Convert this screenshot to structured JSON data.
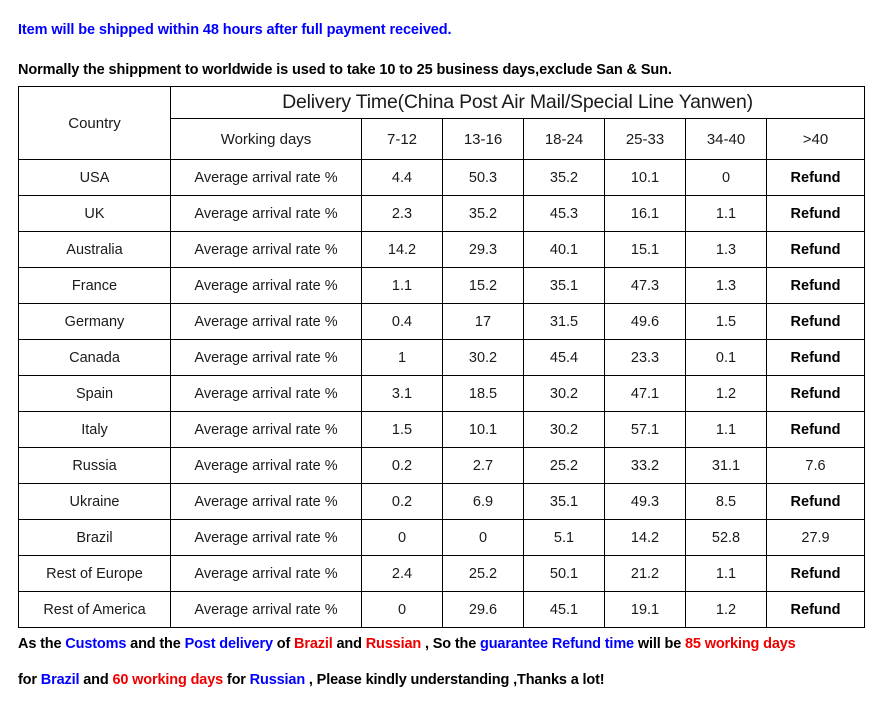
{
  "notices": {
    "line1": "Item will be shipped within 48 hours after full payment received.",
    "line2": "Normally the shippment to worldwide is used to take 10 to 25 business days,exclude San & Sun."
  },
  "colors": {
    "blue": "#0000ff",
    "red": "#ee0000",
    "black": "#000000",
    "border": "#000000",
    "background": "#ffffff"
  },
  "table": {
    "country_header": "Country",
    "title_header": "Delivery Time(China Post Air Mail/Special Line Yanwen)",
    "working_days_header": "Working days",
    "band_headers": [
      "7-12",
      "13-16",
      "18-24",
      "25-33",
      "34-40",
      ">40"
    ],
    "metric_label": "Average arrival rate %",
    "rows": [
      {
        "country": "USA",
        "values": [
          "4.4",
          "50.3",
          "35.2",
          "10.1",
          "0",
          "Refund"
        ]
      },
      {
        "country": "UK",
        "values": [
          "2.3",
          "35.2",
          "45.3",
          "16.1",
          "1.1",
          "Refund"
        ]
      },
      {
        "country": "Australia",
        "values": [
          "14.2",
          "29.3",
          "40.1",
          "15.1",
          "1.3",
          "Refund"
        ]
      },
      {
        "country": "France",
        "values": [
          "1.1",
          "15.2",
          "35.1",
          "47.3",
          "1.3",
          "Refund"
        ]
      },
      {
        "country": "Germany",
        "values": [
          "0.4",
          "17",
          "31.5",
          "49.6",
          "1.5",
          "Refund"
        ]
      },
      {
        "country": "Canada",
        "values": [
          "1",
          "30.2",
          "45.4",
          "23.3",
          "0.1",
          "Refund"
        ]
      },
      {
        "country": "Spain",
        "values": [
          "3.1",
          "18.5",
          "30.2",
          "47.1",
          "1.2",
          "Refund"
        ]
      },
      {
        "country": "Italy",
        "values": [
          "1.5",
          "10.1",
          "30.2",
          "57.1",
          "1.1",
          "Refund"
        ]
      },
      {
        "country": "Russia",
        "values": [
          "0.2",
          "2.7",
          "25.2",
          "33.2",
          "31.1",
          "7.6"
        ]
      },
      {
        "country": "Ukraine",
        "values": [
          "0.2",
          "6.9",
          "35.1",
          "49.3",
          "8.5",
          "Refund"
        ]
      },
      {
        "country": "Brazil",
        "values": [
          "0",
          "0",
          "5.1",
          "14.2",
          "52.8",
          "27.9"
        ]
      },
      {
        "country": "Rest of Europe",
        "values": [
          "2.4",
          "25.2",
          "50.1",
          "21.2",
          "1.1",
          "Refund"
        ]
      },
      {
        "country": "Rest of America",
        "values": [
          "0",
          "29.6",
          "45.1",
          "19.1",
          "1.2",
          "Refund"
        ]
      }
    ]
  },
  "footer": {
    "line1": [
      {
        "text": "As the ",
        "color": "black"
      },
      {
        "text": "Customs",
        "color": "blue"
      },
      {
        "text": " and the ",
        "color": "black"
      },
      {
        "text": "Post delivery",
        "color": "blue"
      },
      {
        "text": " of ",
        "color": "black"
      },
      {
        "text": "Brazil",
        "color": "red"
      },
      {
        "text": " and ",
        "color": "black"
      },
      {
        "text": "Russian",
        "color": "red"
      },
      {
        "text": " , So the ",
        "color": "black"
      },
      {
        "text": "guarantee Refund time",
        "color": "blue"
      },
      {
        "text": " will be ",
        "color": "black"
      },
      {
        "text": "85 working days",
        "color": "red"
      }
    ],
    "line2": [
      {
        "text": "for ",
        "color": "black"
      },
      {
        "text": "Brazil",
        "color": "blue"
      },
      {
        "text": " and ",
        "color": "black"
      },
      {
        "text": "60 working days",
        "color": "red"
      },
      {
        "text": " for ",
        "color": "black"
      },
      {
        "text": "Russian",
        "color": "blue"
      },
      {
        "text": " , Please kindly understanding ,Thanks a lot!",
        "color": "black"
      }
    ]
  }
}
